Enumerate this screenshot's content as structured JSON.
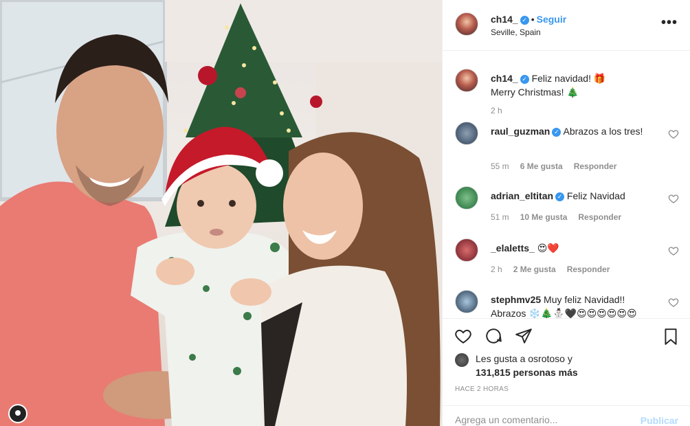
{
  "post": {
    "username": "ch14_",
    "follow_label": "Seguir",
    "location": "Seville, Spain",
    "more_label": "•••"
  },
  "caption": {
    "username": "ch14_",
    "line1": "Feliz navidad! 🎁",
    "line2": "Merry Christmas! 🎄",
    "time": "2 h"
  },
  "comments": [
    {
      "username": "raul_guzman",
      "verified": true,
      "text": "Abrazos a los tres!",
      "time": "55 m",
      "likes": "6 Me gusta",
      "reply": "Responder"
    },
    {
      "username": "adrian_eltitan",
      "verified": true,
      "text": "Feliz Navidad",
      "time": "51 m",
      "likes": "10 Me gusta",
      "reply": "Responder"
    },
    {
      "username": "_elaletts_",
      "verified": false,
      "text": "😍❤️",
      "time": "2 h",
      "likes": "2 Me gusta",
      "reply": "Responder"
    },
    {
      "username": "stephmv25",
      "verified": false,
      "text": "Muy feliz Navidad!! Abrazos ❄️🎄⛄🖤😍😍😍😍😍😍",
      "time": "",
      "likes": "",
      "reply": ""
    }
  ],
  "likes": {
    "line1": "Les gusta a osrotoso y",
    "line2": "131,815 personas más"
  },
  "time_ago": "HACE 2 HORAS",
  "comment_input": {
    "placeholder": "Agrega un comentario..."
  },
  "publish_label": "Publicar",
  "icons": [
    "heart-icon",
    "comment-icon",
    "share-icon",
    "bookmark-icon",
    "more-icon",
    "verified-icon",
    "tag-icon"
  ],
  "colors": {
    "link_blue": "#3897f0",
    "verified_blue": "#3897f0",
    "muted_gray": "#8e8e8e",
    "publish_disabled": "#b3dbff"
  }
}
